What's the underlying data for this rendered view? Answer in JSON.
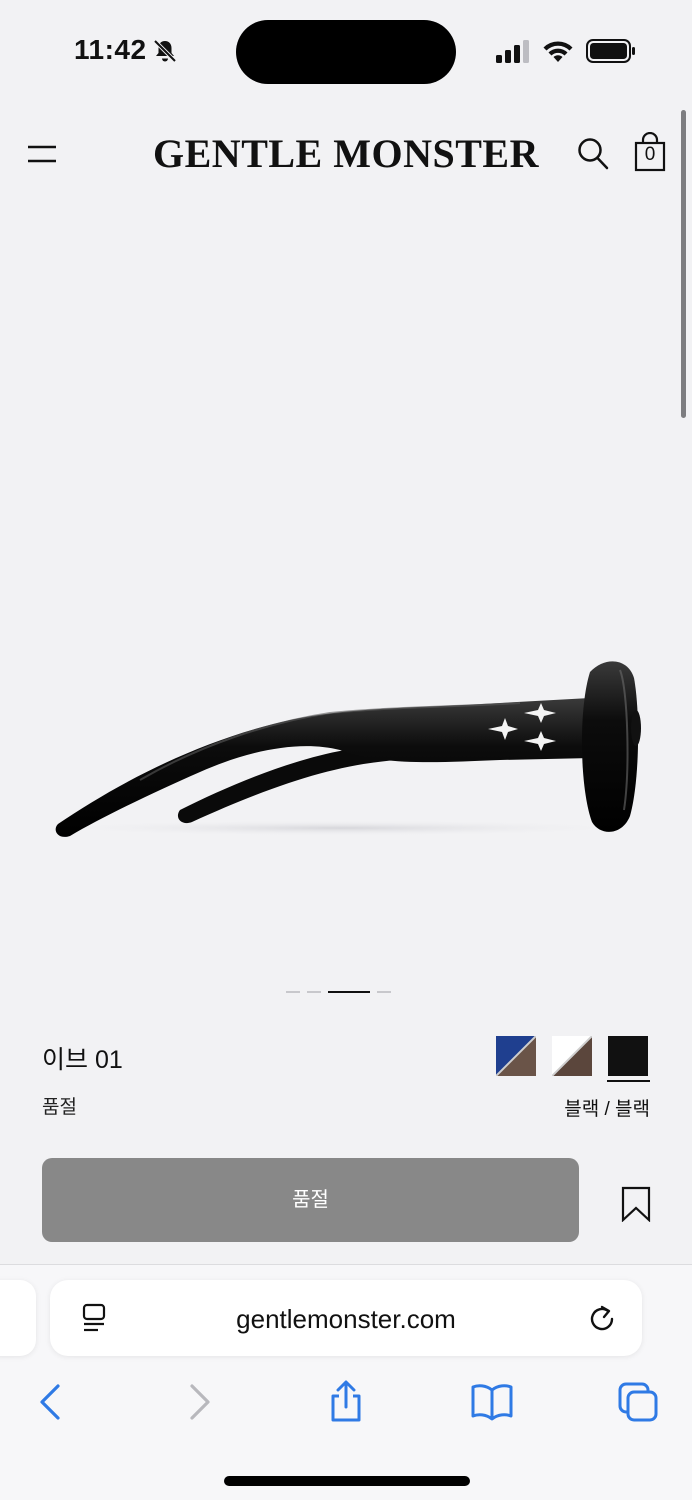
{
  "status_bar": {
    "time": "11:42",
    "icons": [
      "bell-slash-icon",
      "signal-icon",
      "wifi-icon",
      "battery-icon"
    ]
  },
  "header": {
    "brand": "GENTLE MONSTER",
    "cart_count": "0",
    "icons": [
      "menu-icon",
      "search-icon",
      "shopping-bag-icon"
    ]
  },
  "carousel": {
    "total": 4,
    "active_index": 2
  },
  "product": {
    "name": "이브 01",
    "status": "품절",
    "color_name": "블랙 / 블랙",
    "swatches": [
      {
        "name": "blue-brown",
        "colors": [
          "#1f3f8f",
          "#6a5448"
        ]
      },
      {
        "name": "white-brown",
        "colors": [
          "#ffffff",
          "#5b463c"
        ]
      },
      {
        "name": "black",
        "colors": [
          "#111111",
          "#111111"
        ],
        "selected": true
      }
    ]
  },
  "cta": {
    "button_label": "품절",
    "button_color": "#888888"
  },
  "browser": {
    "url": "gentlemonster.com",
    "toolbar_icons": [
      "back-icon",
      "forward-icon",
      "share-icon",
      "bookmarks-icon",
      "tabs-icon"
    ]
  }
}
